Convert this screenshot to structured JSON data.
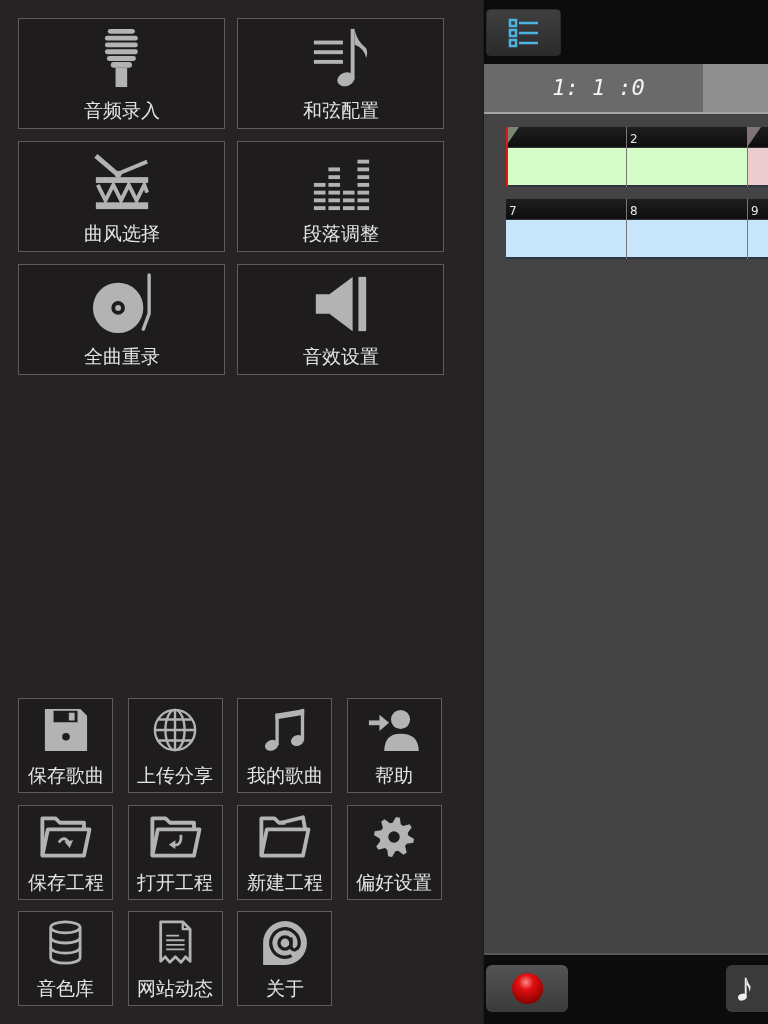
{
  "menu_tiles": [
    {
      "label": "音频录入"
    },
    {
      "label": "和弦配置"
    },
    {
      "label": "曲风选择"
    },
    {
      "label": "段落调整"
    },
    {
      "label": "全曲重录"
    },
    {
      "label": "音效设置"
    }
  ],
  "action_tiles": [
    {
      "label": "保存歌曲"
    },
    {
      "label": "上传分享"
    },
    {
      "label": "我的歌曲"
    },
    {
      "label": "帮助"
    },
    {
      "label": "保存工程"
    },
    {
      "label": "打开工程"
    },
    {
      "label": "新建工程"
    },
    {
      "label": "偏好设置"
    },
    {
      "label": "音色库"
    },
    {
      "label": "网站动态"
    },
    {
      "label": "关于"
    }
  ],
  "position_display": "1: 1 :0",
  "tracks": [
    {
      "measures": [
        {
          "color": "#d5fbc6",
          "section_start": true,
          "playhead": true
        },
        {
          "number": "2",
          "color": "#d5fbc6",
          "section_start": false,
          "playhead": false
        },
        {
          "color": "#ebcdd0",
          "section_start": true,
          "playhead": false
        }
      ]
    },
    {
      "measures": [
        {
          "number": "7",
          "color": "#c7e5fb",
          "section_start": false,
          "playhead": false
        },
        {
          "number": "8",
          "color": "#c7e5fb",
          "section_start": false,
          "playhead": false
        },
        {
          "number": "9",
          "color": "#c7e5fb",
          "section_start": false,
          "playhead": false
        }
      ]
    }
  ]
}
